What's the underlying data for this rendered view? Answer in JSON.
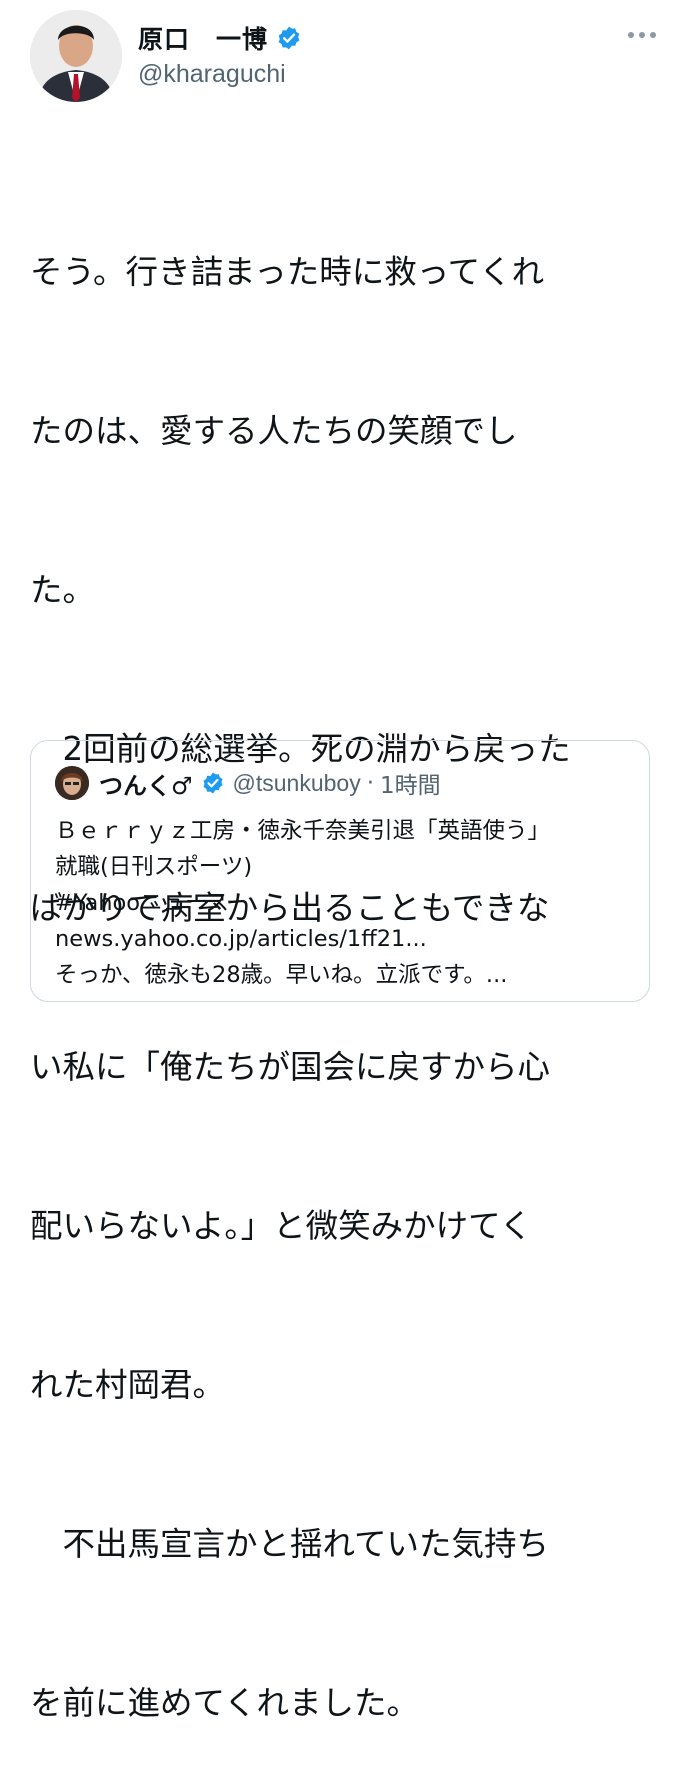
{
  "author": {
    "display_name": "原口　一博",
    "handle": "@kharaguchi",
    "verified": true
  },
  "tweet": {
    "lines": [
      "そう。行き詰まった時に救ってくれ",
      "たのは、愛する人たちの笑顔でし",
      "た。",
      "　2回前の総選挙。死の淵から戻った",
      "ばかりで病室から出ることもできな",
      "い私に「俺たちが国会に戻すから心",
      "配いらないよ。」と微笑みかけてく",
      "れた村岡君。",
      "　不出馬宣言かと揺れていた気持ち",
      "を前に進めてくれました。"
    ]
  },
  "quote": {
    "display_name": "つんく♂",
    "handle": "@tsunkuboy",
    "separator": "·",
    "time": "1時間",
    "lines": [
      "Ｂｅｒｒｙｚ工房・徳永千奈美引退「英語使う」",
      "就職(日刊スポーツ)",
      "#Yahooニュース",
      "news.yahoo.co.jp/articles/1ff21...",
      "そっか、徳永も28歳。早いね。立派です。..."
    ]
  },
  "colors": {
    "verified_blue": "#1d9bf0",
    "secondary_text": "#536471",
    "border": "#cfd9de"
  },
  "icons": {
    "verified": "verified-badge-icon",
    "more": "more-horizontal-icon"
  }
}
